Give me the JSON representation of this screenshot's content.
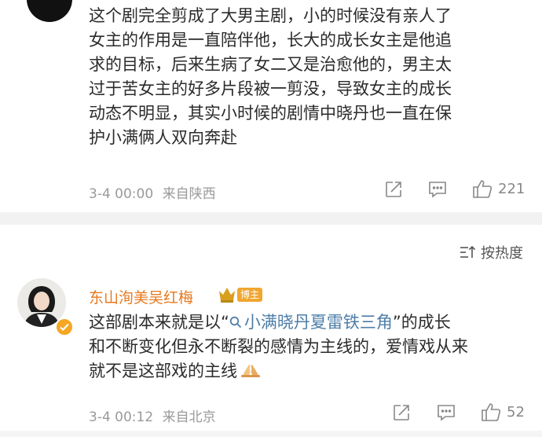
{
  "comment1": {
    "lines": [
      "这个剧完全剪成了大男主剧，小的时候没有亲人了",
      "女主的作用是一直陪伴他，长大的成长女主是他追",
      "求的目标，后来生病了女二又是治愈他的，男主太",
      "过于苦女主的好多片段被一剪没，导致女主的成长",
      "动态不明显，其实小时候的剧情中晓丹也一直在保",
      "护小满俩人双向奔赴"
    ],
    "time": "3-4 00:00",
    "location": "来自陕西",
    "like_count": "221"
  },
  "sort": {
    "label": "按热度"
  },
  "comment2": {
    "username": "东山洵美吴红梅",
    "badge": "博主",
    "line1_before": "这部剧本来就是以“",
    "topic": "小满晓丹夏雷铁三角",
    "line1_after": "”的成长",
    "line2": "和不断变化但永不断裂的感情为主线的，爱情戏从来",
    "line3": "就不是这部戏的主线",
    "time": "3-4 00:12",
    "location": "来自北京",
    "like_count": "52"
  },
  "colors": {
    "username": "#e8791e",
    "topic": "#4e7ea8",
    "badge": "#f1a630",
    "verified": "#f5a623"
  },
  "icons": [
    "avatar",
    "share-icon",
    "comment-icon",
    "like-icon",
    "sort-icon",
    "crown-icon",
    "verified-icon",
    "search-icon",
    "pray-emoji"
  ]
}
